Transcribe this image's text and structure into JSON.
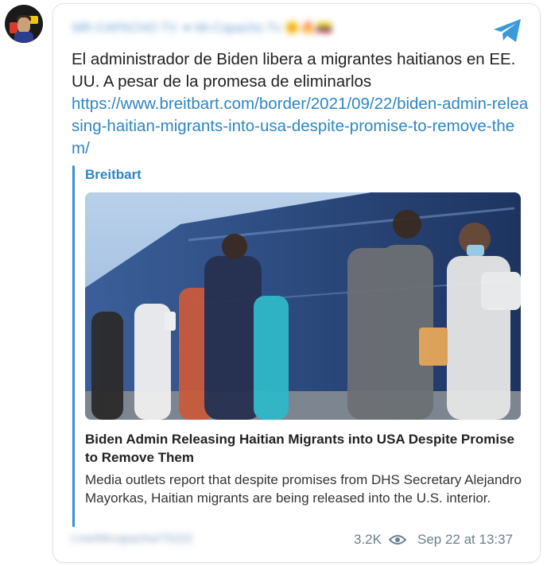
{
  "channel": {
    "name": "MR.CAPACHO TV ➜ Mr.Capacho Tv 🌞🔥🇪🇨",
    "icons": {
      "avatar": "channel-avatar",
      "platform": "telegram-plane-icon"
    }
  },
  "post": {
    "text": "El administrador de Biden libera a migrantes haitianos en EE. UU. A pesar de la promesa de eliminarlos",
    "link": "https://www.breitbart.com/border/2021/09/22/biden-admin-releasing-haitian-migrants-into-usa-despite-promise-to-remove-them/"
  },
  "preview": {
    "site": "Breitbart",
    "title": "Biden Admin Releasing Haitian Migrants into USA Despite Promise to Remove Them",
    "description": "Media outlets report that despite promises from DHS Secretary Alejandro Mayorkas, Haitian migrants are being released into the U.S. interior.",
    "accent_color": "#3d8fd1"
  },
  "footer": {
    "author": "t.me/Mrcapacho/75222",
    "views": "3.2K",
    "views_icon": "eye-icon",
    "date": "Sep 22 at 13:37"
  }
}
